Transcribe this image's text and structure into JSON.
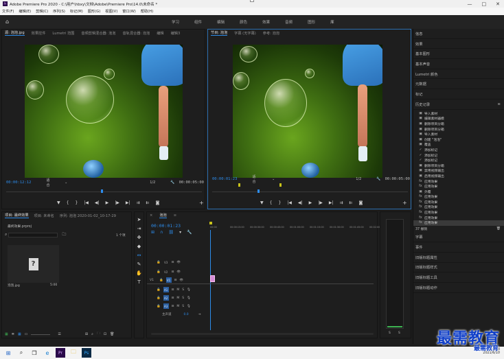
{
  "window": {
    "title": "Adobe Premiere Pro 2020 - C:\\用户\\hbxy\\文档\\Adobe\\Premiere Pro\\14.0\\未命名 *",
    "controls": [
      "—",
      "□",
      "✕"
    ]
  },
  "menu": [
    "文件(F)",
    "编辑(E)",
    "剪辑(C)",
    "序列(S)",
    "标记(M)",
    "图形(G)",
    "视图(V)",
    "窗口(W)",
    "帮助(H)"
  ],
  "workspaces": [
    "学习",
    "组件",
    "编辑",
    "颜色",
    "效果",
    "音频",
    "图形",
    "库"
  ],
  "workspace_more": "»",
  "source_monitor": {
    "tabs": [
      "源: 泡泡.jpg",
      "效果控件",
      "Lumetri 范围",
      "音频剪辑混合器: 泡泡",
      "音轨混合器: 泡泡",
      "编辑",
      "编辑3"
    ],
    "active_tab": "源: 泡泡.jpg",
    "timecode": "00:00:12:12",
    "fit": "适合",
    "quality": "1/2",
    "duration": "00:00:05:00"
  },
  "program_monitor": {
    "tabs": [
      "节目: 泡泡",
      "字幕 (无字幕)",
      "参考: 泡泡"
    ],
    "active_tab": "节目: 泡泡",
    "timecode": "00:00:01:23",
    "fit": "适合",
    "quality": "1/2",
    "duration": "00:00:05:00"
  },
  "transport_icons": [
    "▼",
    "{",
    "}",
    "|◀",
    "◀|",
    "▶",
    "|▶",
    "▶|",
    "⇉",
    "⇇",
    "◙",
    "+"
  ],
  "right_panel": {
    "top_items": [
      "信息",
      "效果",
      "基本图形",
      "基本声音",
      "Lumetri 颜色",
      "元数据",
      "标记"
    ],
    "history_title": "历史记录",
    "history": [
      {
        "icon": "▣",
        "label": "导入素材"
      },
      {
        "icon": "▣",
        "label": "编辑素材器模"
      },
      {
        "icon": "▣",
        "label": "删除项目分箱"
      },
      {
        "icon": "▣",
        "label": "删除项目分箱"
      },
      {
        "icon": "▣",
        "label": "导入素材"
      },
      {
        "icon": "▣",
        "label": "创建 \"泡泡\""
      },
      {
        "icon": "▣",
        "label": "覆盖"
      },
      {
        "icon": "✓",
        "label": "添加标记"
      },
      {
        "icon": "✓",
        "label": "添加标记"
      },
      {
        "icon": "✓",
        "label": "添加标记"
      },
      {
        "icon": "▣",
        "label": "删除项目分箱"
      },
      {
        "icon": "▣",
        "label": "禁用视频输出"
      },
      {
        "icon": "▣",
        "label": "启用视频输出"
      },
      {
        "icon": "fx",
        "label": "应用效果"
      },
      {
        "icon": "fx",
        "label": "应用效果"
      },
      {
        "icon": "▣",
        "label": "外覆"
      },
      {
        "icon": "fx",
        "label": "应用效果"
      },
      {
        "icon": "fx",
        "label": "应用效果"
      },
      {
        "icon": "fx",
        "label": "应用效果"
      },
      {
        "icon": "fx",
        "label": "应用效果"
      },
      {
        "icon": "fx",
        "label": "应用效果"
      },
      {
        "icon": "fx",
        "label": "应用效果"
      }
    ],
    "history_selected_index": 21,
    "history_footer": "37 撤销",
    "bottom_items": [
      "字幕",
      "事件",
      "旧版标题属性",
      "旧版标题样式",
      "旧版标题工具",
      "旧版标题动作"
    ]
  },
  "project_panel": {
    "tabs": [
      "项目: 最终效果",
      "项目: 未命名",
      "序列: 泡泡 2020-01-02_10-17-29"
    ],
    "file": "最终效果.prproj",
    "search_placeholder": "",
    "count": "1 个项",
    "item_name": "泡泡.jpg",
    "item_duration": "5:00"
  },
  "timeline": {
    "title": "泡泡",
    "timecode": "00:00:01:23",
    "ruler": [
      "00:00",
      "00:00:15:00",
      "00:00:30:00",
      "00:00:45:00",
      "00:01:00:00",
      "00:01:15:00",
      "00:01:30:00",
      "00:01:45:00",
      "00:02:00:00"
    ],
    "video_tracks": [
      "V3",
      "V2",
      "V1"
    ],
    "audio_tracks": [
      "A1",
      "A2",
      "A3"
    ],
    "source_patch": "V1",
    "master_label": "主声道",
    "master_value": "0.0"
  },
  "audio_meter": {
    "labels": [
      "S",
      "S"
    ]
  },
  "taskbar": {
    "clock_time": "10:28",
    "clock_date": "2021/6/10"
  },
  "watermark": {
    "big": "最需教育",
    "small": "最需教育"
  }
}
